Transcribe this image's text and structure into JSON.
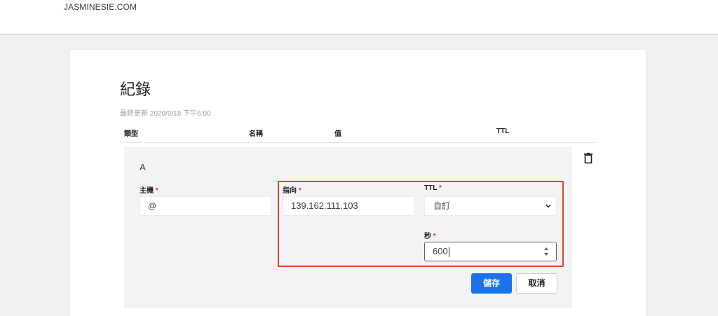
{
  "header": {
    "site_name": "JASMINESIE.COM"
  },
  "page": {
    "title": "紀錄",
    "last_updated": "最終更新 2020/9/18 下午6:00"
  },
  "table": {
    "columns": [
      "類型",
      "名稱",
      "值",
      "TTL"
    ]
  },
  "record": {
    "type": "A",
    "host": {
      "label": "主機",
      "required_mark": "*",
      "value": "@"
    },
    "target": {
      "label": "指向",
      "required_mark": "*",
      "value": "139.162.111.103"
    },
    "ttl": {
      "label": "TTL",
      "required_mark": "*",
      "selected": "自訂"
    },
    "seconds": {
      "label": "秒",
      "required_mark": "*",
      "value": "600"
    }
  },
  "actions": {
    "save_label": "儲存",
    "cancel_label": "取消"
  },
  "icons": {
    "delete": "trash-icon",
    "select_arrow": "chevron-down-icon",
    "stepper": "stepper-arrows-icon"
  },
  "colors": {
    "primary": "#1a73e8",
    "required": "#d93025",
    "highlight": "#e0452c"
  }
}
